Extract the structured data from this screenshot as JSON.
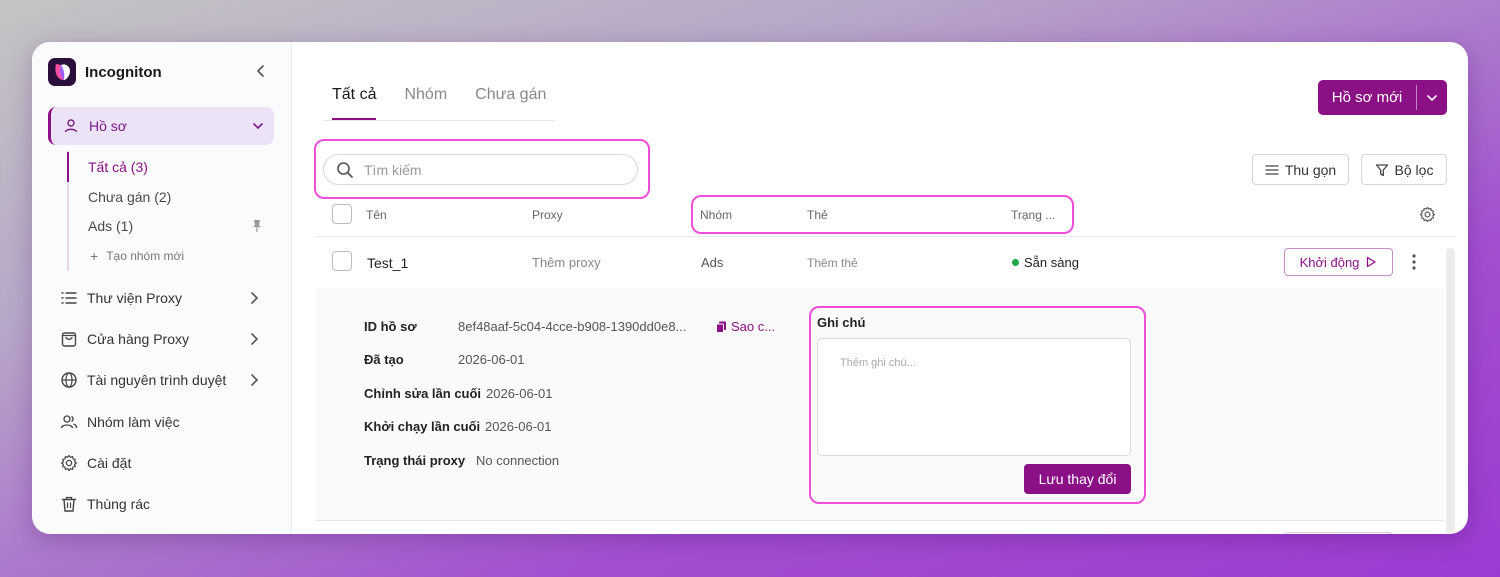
{
  "app": {
    "name": "Incogniton"
  },
  "sidebar": {
    "profiles": {
      "label": "Hồ sơ"
    },
    "sub_items": [
      {
        "label": "Tất cả (3)"
      },
      {
        "label": "Chưa gán (2)"
      },
      {
        "label": "Ads (1)"
      }
    ],
    "new_group": "Tạo nhóm mới",
    "items": [
      {
        "label": "Thư viện Proxy",
        "icon": "list-icon"
      },
      {
        "label": "Cửa hàng Proxy",
        "icon": "shopping-bag-icon"
      },
      {
        "label": "Tài nguyên trình duyệt",
        "icon": "globe-icon"
      },
      {
        "label": "Nhóm làm việc",
        "icon": "users-icon"
      },
      {
        "label": "Cài đặt",
        "icon": "gear-icon"
      },
      {
        "label": "Thùng rác",
        "icon": "trash-icon"
      }
    ]
  },
  "tabs": [
    {
      "label": "Tất cả"
    },
    {
      "label": "Nhóm"
    },
    {
      "label": "Chưa gán"
    }
  ],
  "toolbar": {
    "new_profile": "Hồ sơ mới",
    "search_placeholder": "Tìm kiếm",
    "collapse": "Thu gọn",
    "filter": "Bộ lọc"
  },
  "table": {
    "columns": {
      "name": "Tên",
      "proxy": "Proxy",
      "group": "Nhóm",
      "tags": "Thẻ",
      "status": "Trạng ..."
    },
    "row": {
      "name": "Test_1",
      "proxy": "Thêm proxy",
      "group": "Ads",
      "tags": "Thêm thẻ",
      "status": "Sẵn sàng",
      "start": "Khởi động"
    }
  },
  "details": {
    "id_label": "ID hồ sơ",
    "id_value": "8ef48aaf-5c04-4cce-b908-1390dd0e8...",
    "copy": "Sao c...",
    "created_label": "Đã tạo",
    "created_value": "2026-06-01",
    "edited_label": "Chỉnh sửa lần cuối",
    "edited_value": "2026-06-01",
    "launched_label": "Khởi chạy lần cuối",
    "launched_value": "2026-06-01",
    "proxy_status_label": "Trạng thái proxy",
    "proxy_status_value": "No connection"
  },
  "notes": {
    "title": "Ghi chú",
    "placeholder": "Thêm ghi chú...",
    "save": "Lưu thay đổi"
  },
  "colors": {
    "accent": "#8b0f85",
    "highlight": "#f04ed8",
    "status_ready": "#1ea84a"
  }
}
